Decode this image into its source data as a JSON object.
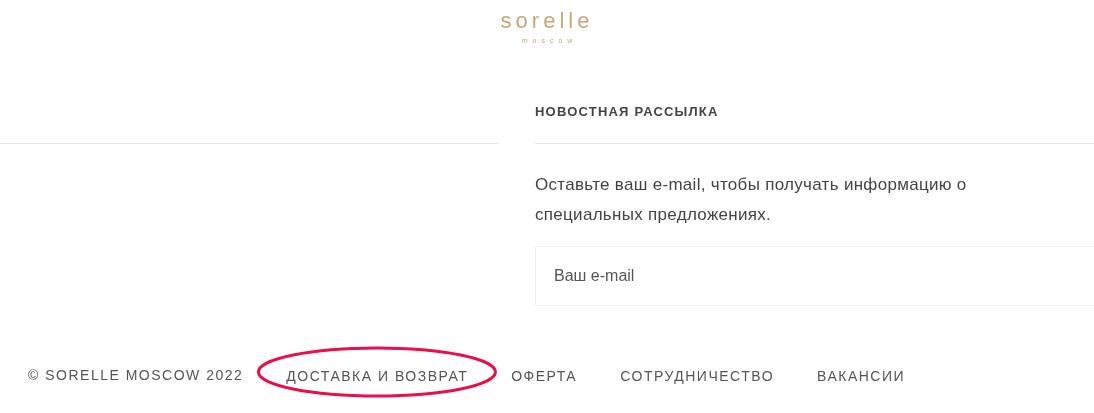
{
  "logo": {
    "name": "sorelle",
    "city": "moscow"
  },
  "newsletter": {
    "heading": "НОВОСТНАЯ РАССЫЛКА",
    "text_lines": [
      "Оставьте ваш e-mail, чтобы получать информацию о",
      "специальных предложениях."
    ],
    "email_field": {
      "placeholder": "Ваш e-mail"
    }
  },
  "footer": {
    "copyright": "© SORELLE MOSCOW 2022",
    "links": [
      {
        "label": "ДОСТАВКА И ВОЗВРАТ",
        "circled": true
      },
      {
        "label": "ОФЕРТА",
        "circled": false
      },
      {
        "label": "СОТРУДНИЧЕСТВО",
        "circled": false
      },
      {
        "label": "ВАКАНСИИ",
        "circled": false
      }
    ]
  },
  "annotation": {
    "kind": "ellipse",
    "color": "#e8104a"
  }
}
